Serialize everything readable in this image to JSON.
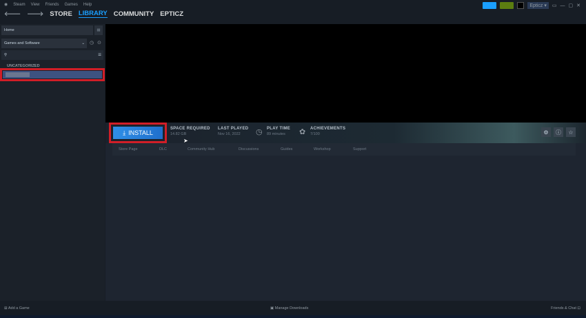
{
  "menu": {
    "items": [
      "Steam",
      "View",
      "Friends",
      "Games",
      "Help"
    ]
  },
  "nav": {
    "tabs": [
      "STORE",
      "LIBRARY",
      "COMMUNITY",
      "EPTICZ"
    ],
    "active": "LIBRARY"
  },
  "account": {
    "name": "Epticz"
  },
  "sidebar": {
    "home": "Home",
    "filter": "Games and Software",
    "category": "UNCATEGORIZED"
  },
  "game": {
    "install_label": "INSTALL",
    "stats": [
      {
        "label": "SPACE REQUIRED",
        "value": "14.82 GB"
      },
      {
        "label": "LAST PLAYED",
        "value": "Nov 16, 2022"
      },
      {
        "label": "PLAY TIME",
        "value": "89 minutes"
      },
      {
        "label": "ACHIEVEMENTS",
        "value": "7/100"
      }
    ],
    "tabs": [
      "Store Page",
      "DLC",
      "Community Hub",
      "Discussions",
      "Guides",
      "Workshop",
      "Support"
    ]
  },
  "footer": {
    "add_game": "Add a Game",
    "manage_downloads": "Manage Downloads",
    "friends_chat": "Friends & Chat"
  },
  "colors": {
    "accent": "#1a9fff",
    "highlight": "#d11e27"
  }
}
